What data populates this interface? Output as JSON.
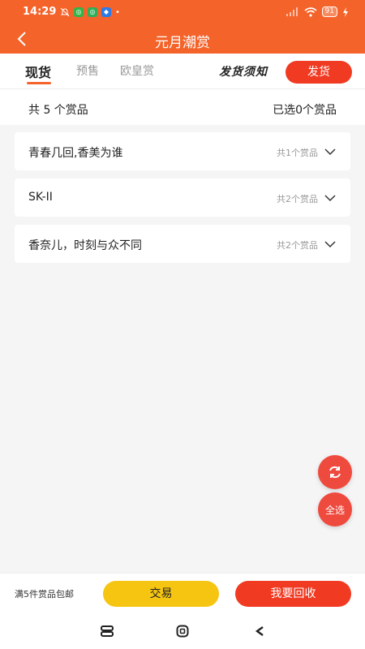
{
  "status_bar": {
    "time": "14:29",
    "battery": "91",
    "icons": [
      "mute-bell-icon",
      "app-icon-green-1",
      "app-icon-green-2",
      "app-icon-blue",
      "dot-icon",
      "signal-icon",
      "wifi-icon",
      "battery-icon",
      "charging-icon"
    ]
  },
  "navbar": {
    "title": "元月潮赏"
  },
  "tabs": [
    {
      "label": "现货",
      "active": true
    },
    {
      "label": "预售",
      "active": false
    },
    {
      "label": "欧皇赏",
      "active": false
    }
  ],
  "notice_link": "发货须知",
  "ship_button": "发货",
  "summary": {
    "total": "共 5 个赏品",
    "selected": "已选0个赏品"
  },
  "groups": [
    {
      "name": "青春几回,香美为谁",
      "count": "共1个赏品"
    },
    {
      "name": "SK-II",
      "count": "共2个赏品"
    },
    {
      "name": "香奈儿，时刻与众不同",
      "count": "共2个赏品"
    }
  ],
  "float_buttons": {
    "refresh_icon": "refresh-icon",
    "select_all": "全选"
  },
  "bottom_bar": {
    "free_shipping": "满5件赏品包邮",
    "trade": "交易",
    "recycle": "我要回收"
  },
  "colors": {
    "accent": "#f4632a",
    "danger": "#f03a22",
    "yellow": "#f6c512"
  }
}
